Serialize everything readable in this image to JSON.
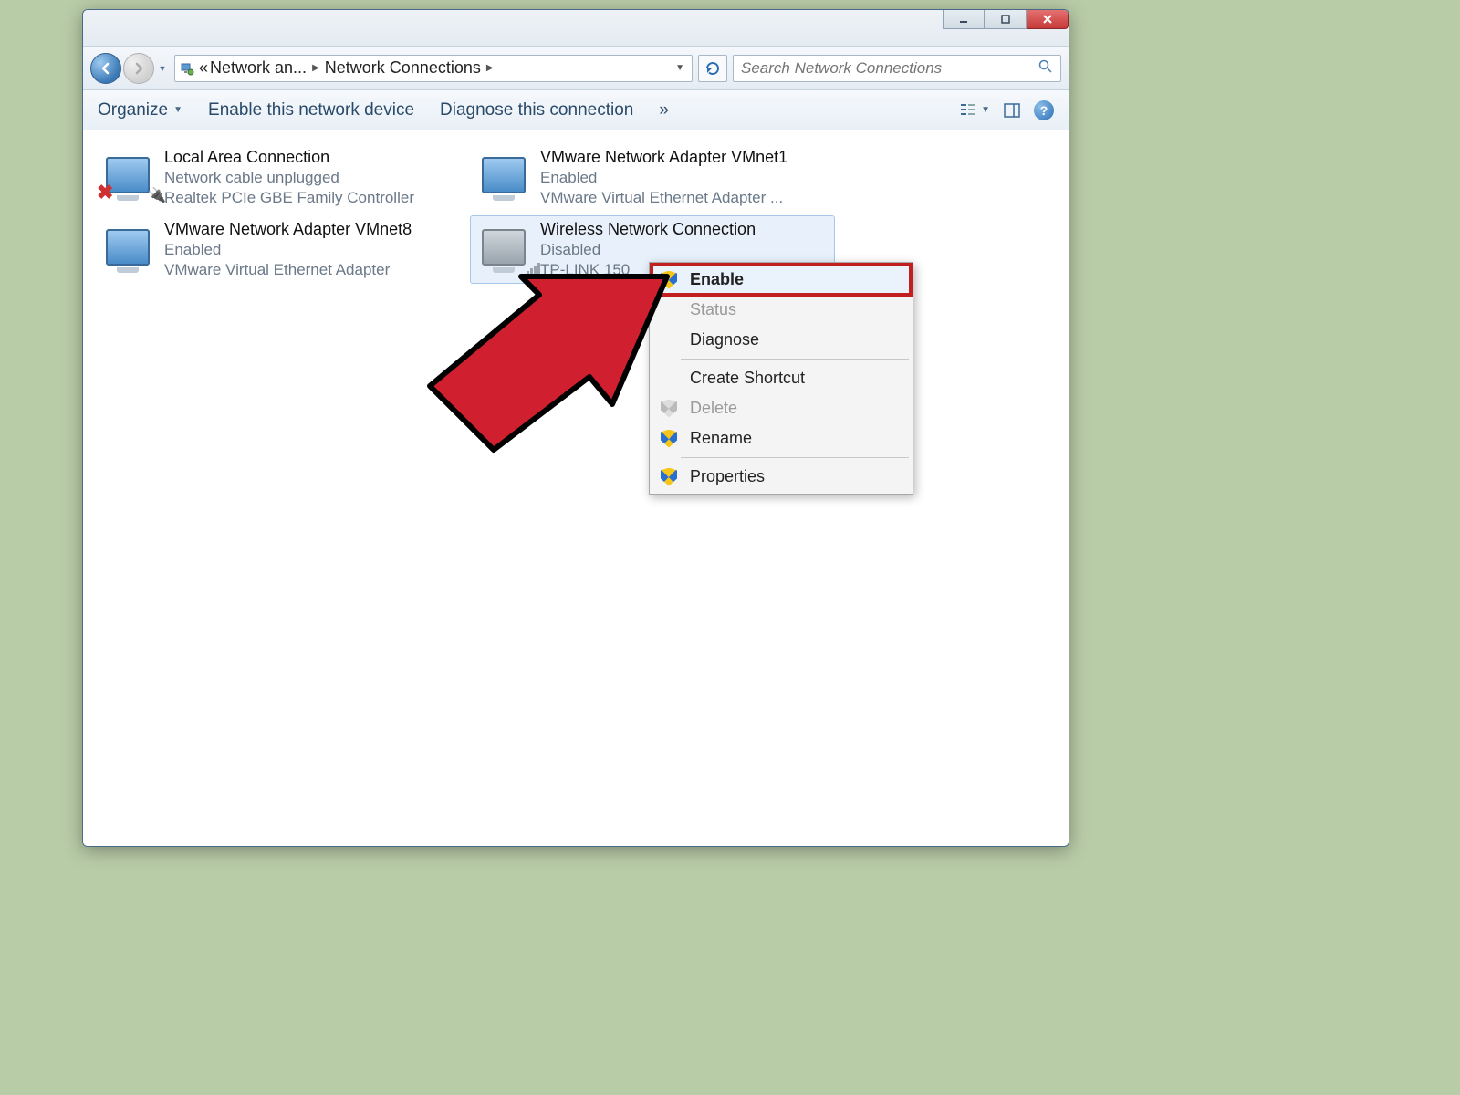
{
  "breadcrumb": {
    "level1": "Network an...",
    "level2": "Network Connections"
  },
  "search": {
    "placeholder": "Search Network Connections"
  },
  "toolbar": {
    "organize": "Organize",
    "enable_device": "Enable this network device",
    "diagnose": "Diagnose this connection",
    "overflow": "»"
  },
  "connections": [
    {
      "title": "Local Area Connection",
      "status": "Network cable unplugged",
      "device": "Realtek PCIe GBE Family Controller",
      "icon": "lan-unplugged"
    },
    {
      "title": "VMware Network Adapter VMnet1",
      "status": "Enabled",
      "device": "VMware Virtual Ethernet Adapter ...",
      "icon": "lan"
    },
    {
      "title": "VMware Network Adapter VMnet8",
      "status": "Enabled",
      "device": "VMware Virtual Ethernet Adapter",
      "icon": "lan"
    },
    {
      "title": "Wireless Network Connection",
      "status": "Disabled",
      "device": "TP-LINK 150",
      "icon": "wifi-disabled",
      "selected": true
    }
  ],
  "context_menu": {
    "enable": "Enable",
    "status": "Status",
    "diagnose": "Diagnose",
    "create_shortcut": "Create Shortcut",
    "delete": "Delete",
    "rename": "Rename",
    "properties": "Properties"
  }
}
